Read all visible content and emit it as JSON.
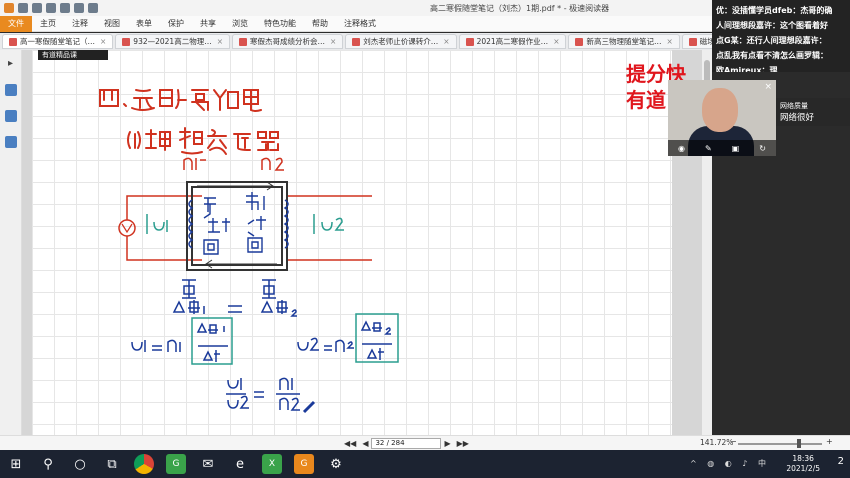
{
  "window": {
    "title": "高二寒假随堂笔记（刘杰）1期.pdf * - 极速阅读器"
  },
  "menu": {
    "file": "文件",
    "items": [
      "主页",
      "注释",
      "视图",
      "表单",
      "保护",
      "共享",
      "浏览",
      "特色功能",
      "帮助",
      "注释格式"
    ]
  },
  "tabs": [
    {
      "label": "高一寒假随堂笔记（…",
      "active": true
    },
    {
      "label": "932—2021高二物理…",
      "active": false
    },
    {
      "label": "寒假杰哥成绩分析会…",
      "active": false
    },
    {
      "label": "刘杰老师止价课转介…",
      "active": false
    },
    {
      "label": "2021高二寒假作业…",
      "active": false
    },
    {
      "label": "新高三物理随堂笔记…",
      "active": false
    },
    {
      "label": "磁场中粒子运动…",
      "active": false
    }
  ],
  "overlay": {
    "logo_text": "有道精品课",
    "promo_line1": "提分快",
    "promo_line2": "有道"
  },
  "chat": {
    "messages": [
      "优：没插懂学员dfeb：杰哥的确",
      "人间理想段嘉许：这个图看着好",
      "点G某：还行人间理想段嘉许：",
      "点乱我有点看不清怎么画罗辑：",
      "欧Amireux：理"
    ]
  },
  "video": {
    "network_label": "网络质量",
    "network_value": "网络很好"
  },
  "statusbar": {
    "page_display": "32 / 284",
    "zoom": "141.72%"
  },
  "taskbar": {
    "time": "18:36",
    "date": "2021/2/5",
    "notification_count": "2"
  },
  "colors": {
    "ink": "#1a3a9a",
    "red_ink": "#e0161d",
    "green_ink": "#2a9d8f",
    "accent_orange": "#e98a1f"
  }
}
